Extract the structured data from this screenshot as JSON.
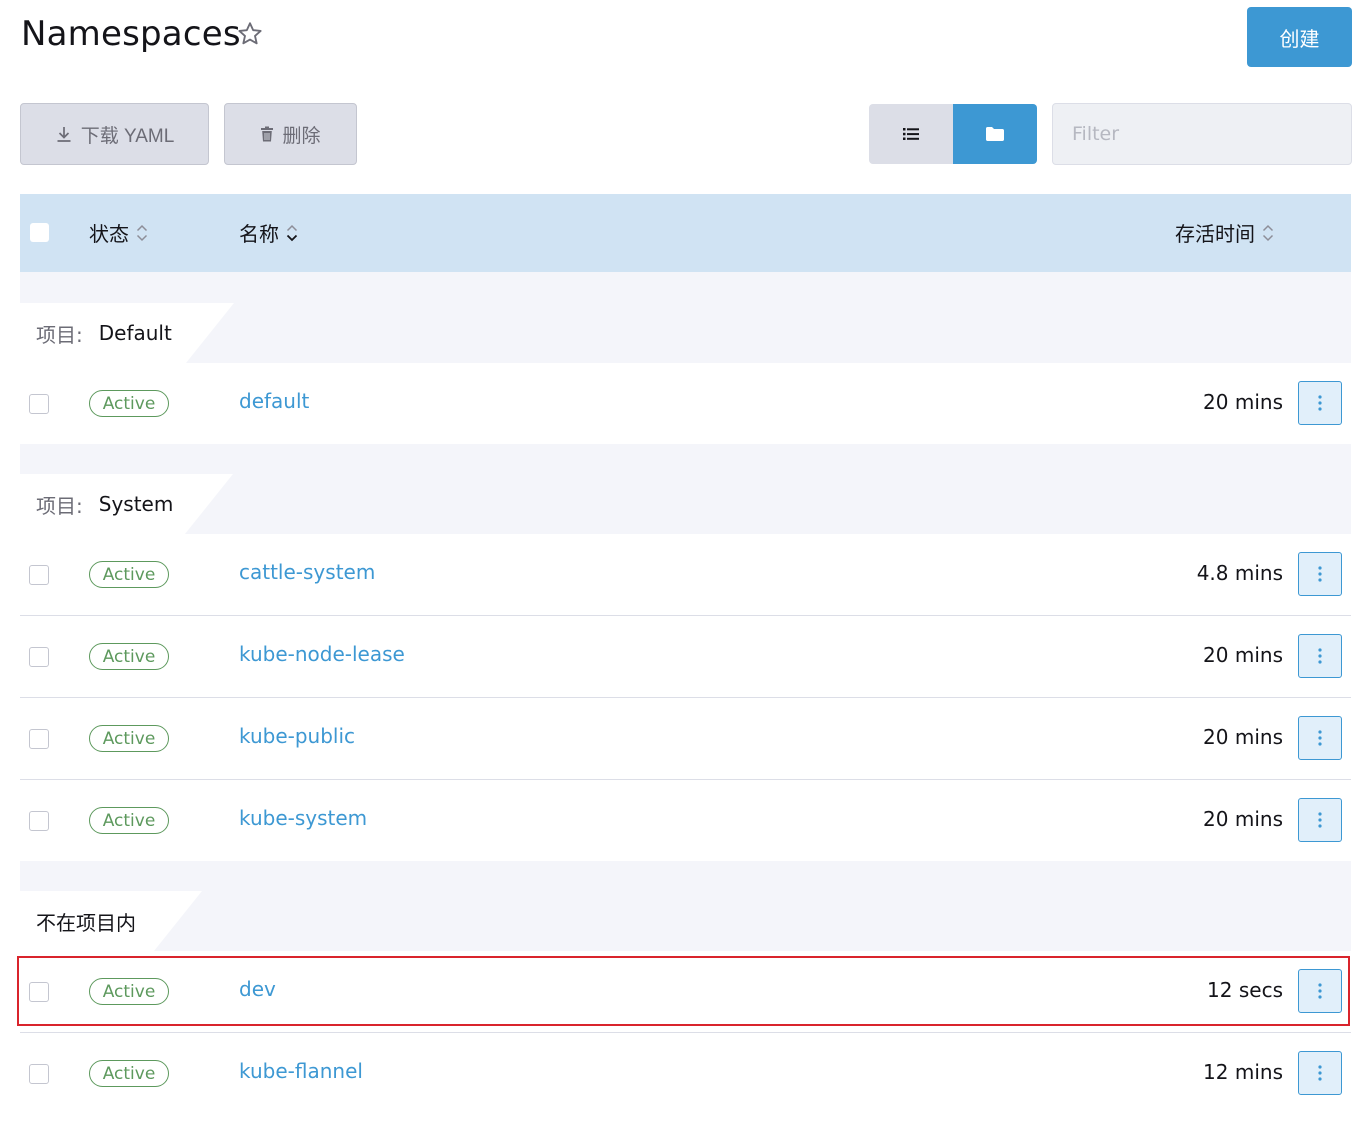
{
  "header": {
    "title": "Namespaces",
    "create_label": "创建"
  },
  "toolbar": {
    "download_label": "下载 YAML",
    "delete_label": "删除",
    "filter_placeholder": "Filter"
  },
  "table": {
    "columns": {
      "state": "状态",
      "name": "名称",
      "age": "存活时间"
    },
    "groups": [
      {
        "label": "项目:",
        "value": "Default",
        "rows": [
          {
            "state": "Active",
            "name": "default",
            "age": "20 mins"
          }
        ]
      },
      {
        "label": "项目:",
        "value": "System",
        "rows": [
          {
            "state": "Active",
            "name": "cattle-system",
            "age": "4.8 mins"
          },
          {
            "state": "Active",
            "name": "kube-node-lease",
            "age": "20 mins"
          },
          {
            "state": "Active",
            "name": "kube-public",
            "age": "20 mins"
          },
          {
            "state": "Active",
            "name": "kube-system",
            "age": "20 mins"
          }
        ]
      },
      {
        "label": "不在项目内",
        "value": "",
        "rows": [
          {
            "state": "Active",
            "name": "dev",
            "age": "12 secs"
          },
          {
            "state": "Active",
            "name": "kube-flannel",
            "age": "12 mins"
          }
        ]
      }
    ]
  },
  "colors": {
    "primary": "#3d98d3",
    "active_green": "#5d995d",
    "header_bg": "#d0e3f3",
    "highlight": "#d9242c"
  }
}
